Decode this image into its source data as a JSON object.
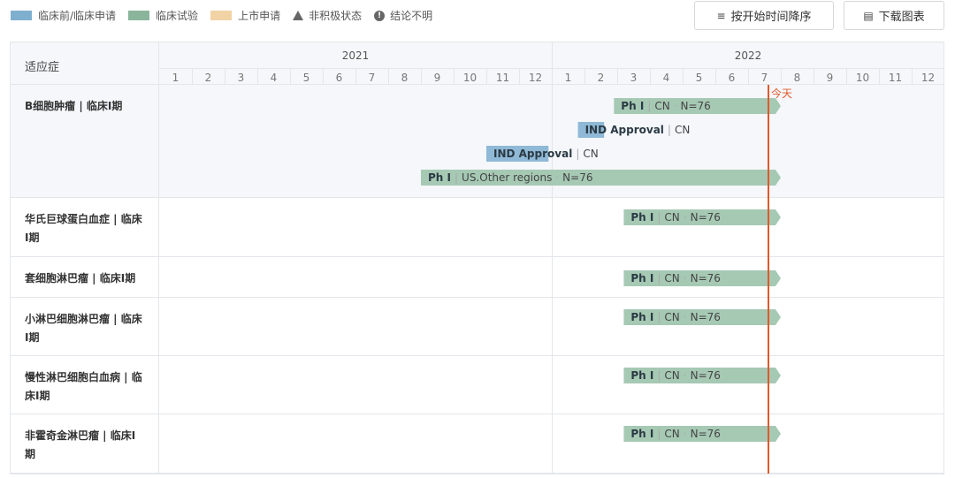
{
  "legend": [
    {
      "label": "临床前/临床申请",
      "color": "#7fafcf",
      "kind": "swatch"
    },
    {
      "label": "临床试验",
      "color": "#8ab59c",
      "kind": "swatch"
    },
    {
      "label": "上市申请",
      "color": "#f2d3a5",
      "kind": "swatch"
    },
    {
      "label": "非积极状态",
      "kind": "triangle-icon"
    },
    {
      "label": "结论不明",
      "kind": "exclamation-icon"
    }
  ],
  "toolbar": {
    "sort_label": "按开始时间降序",
    "sort_icon": "sort-descending-icon",
    "download_label": "下载图表",
    "download_icon": "document-icon"
  },
  "chart_data": {
    "type": "gantt",
    "header": "适应症",
    "years": [
      "2021",
      "2022"
    ],
    "months": [
      "1",
      "2",
      "3",
      "4",
      "5",
      "6",
      "7",
      "8",
      "9",
      "10",
      "11",
      "12"
    ],
    "today_label": "今天",
    "today": "2022-08",
    "colors": {
      "clinical": "#a6c9b4",
      "application": "#8fb9d6",
      "today": "#e0592a"
    },
    "rows": [
      {
        "indication": "B细胞肿瘤 | 临床I期",
        "bars": [
          {
            "start": "2022-02.9",
            "end": "2022-08",
            "type": "clinical",
            "parts": [
              "Ph I",
              "CN",
              "N=76"
            ]
          },
          {
            "start": "2022-01.8",
            "end": "2022-02.6",
            "type": "application",
            "parts": [
              "IND Approval",
              "CN"
            ]
          },
          {
            "start": "2021-11.0",
            "end": "2021-12.9",
            "type": "application",
            "parts": [
              "IND Approval",
              "CN"
            ]
          },
          {
            "start": "2021-09.0",
            "end": "2022-08",
            "type": "clinical",
            "parts": [
              "Ph I",
              "US.Other regions",
              "N=76"
            ]
          }
        ]
      },
      {
        "indication": "华氏巨球蛋白血症 | 临床I期",
        "bars": [
          {
            "start": "2022-03.2",
            "end": "2022-08",
            "type": "clinical",
            "parts": [
              "Ph I",
              "CN",
              "N=76"
            ]
          }
        ]
      },
      {
        "indication": "套细胞淋巴瘤 | 临床I期",
        "bars": [
          {
            "start": "2022-03.2",
            "end": "2022-08",
            "type": "clinical",
            "parts": [
              "Ph I",
              "CN",
              "N=76"
            ]
          }
        ]
      },
      {
        "indication": "小淋巴细胞淋巴瘤 | 临床I期",
        "bars": [
          {
            "start": "2022-03.2",
            "end": "2022-08",
            "type": "clinical",
            "parts": [
              "Ph I",
              "CN",
              "N=76"
            ]
          }
        ]
      },
      {
        "indication": "慢性淋巴细胞白血病 | 临床I期",
        "bars": [
          {
            "start": "2022-03.2",
            "end": "2022-08",
            "type": "clinical",
            "parts": [
              "Ph I",
              "CN",
              "N=76"
            ]
          }
        ]
      },
      {
        "indication": "非霍奇金淋巴瘤 | 临床I期",
        "bars": [
          {
            "start": "2022-03.2",
            "end": "2022-08",
            "type": "clinical",
            "parts": [
              "Ph I",
              "CN",
              "N=76"
            ]
          }
        ]
      }
    ]
  }
}
